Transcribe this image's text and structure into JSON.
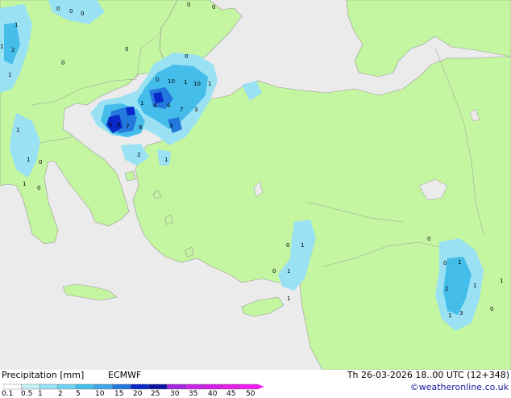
{
  "footer": {
    "title": "Precipitation [mm]",
    "model": "ECMWF",
    "valid_time": "Th 26-03-2026 18..00 UTC (12+348)",
    "credit": "©weatheronline.co.uk"
  },
  "legend": {
    "ticks": [
      "0.1",
      "0.5",
      "1",
      "2",
      "5",
      "10",
      "15",
      "20",
      "25",
      "30",
      "35",
      "40",
      "45",
      "50"
    ],
    "colors": [
      "#ffffff",
      "#c8f0f8",
      "#9ae1f4",
      "#6fd1f0",
      "#45bdea",
      "#3ea6ea",
      "#2478dc",
      "#0a28c8",
      "#0a14a0",
      "#a028e0",
      "#c828e6",
      "#d21ee6",
      "#e61ee6",
      "#f01ef0"
    ]
  },
  "map": {
    "land_color": "#c4f5a0",
    "sea_color": "#ebebeb",
    "precip_labels": [
      "0",
      "0",
      "0",
      "0",
      "1",
      "0",
      "1",
      "2",
      "1",
      "0",
      "0",
      "0",
      "0",
      "10",
      "1",
      "10",
      "1",
      "1",
      "4",
      "6",
      "7",
      "3",
      "5",
      "9",
      "7",
      "8",
      "1",
      "3",
      "2",
      "1",
      "1",
      "0",
      "1",
      "0",
      "0",
      "1",
      "0",
      "1",
      "1",
      "0",
      "1",
      "2",
      "1",
      "1",
      "3",
      "0",
      "0",
      "1"
    ]
  }
}
